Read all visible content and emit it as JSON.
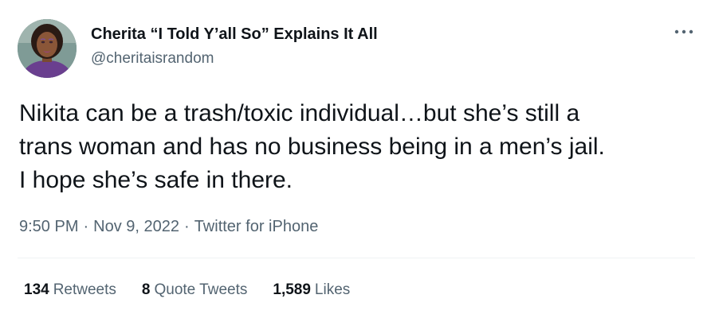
{
  "author": {
    "display_name": "Cherita “I Told Y’all So” Explains It All",
    "handle": "@cheritaisrandom",
    "avatar_icon": "profile-photo"
  },
  "more_icon": "ellipsis-icon",
  "tweet": {
    "lines": [
      "Nikita can be a trash/toxic individual…but she’s still a",
      "trans woman and has no business being in a men’s jail.",
      "I hope she’s safe in there."
    ]
  },
  "meta": {
    "time": "9:50 PM",
    "separator": "·",
    "date": "Nov 9, 2022",
    "source": "Twitter for iPhone"
  },
  "stats": {
    "retweets": {
      "count": "134",
      "label": "Retweets"
    },
    "quotes": {
      "count": "8",
      "label": "Quote Tweets"
    },
    "likes": {
      "count": "1,589",
      "label": "Likes"
    }
  },
  "colors": {
    "text": "#0f1419",
    "secondary": "#536471",
    "divider": "#eff3f4"
  }
}
